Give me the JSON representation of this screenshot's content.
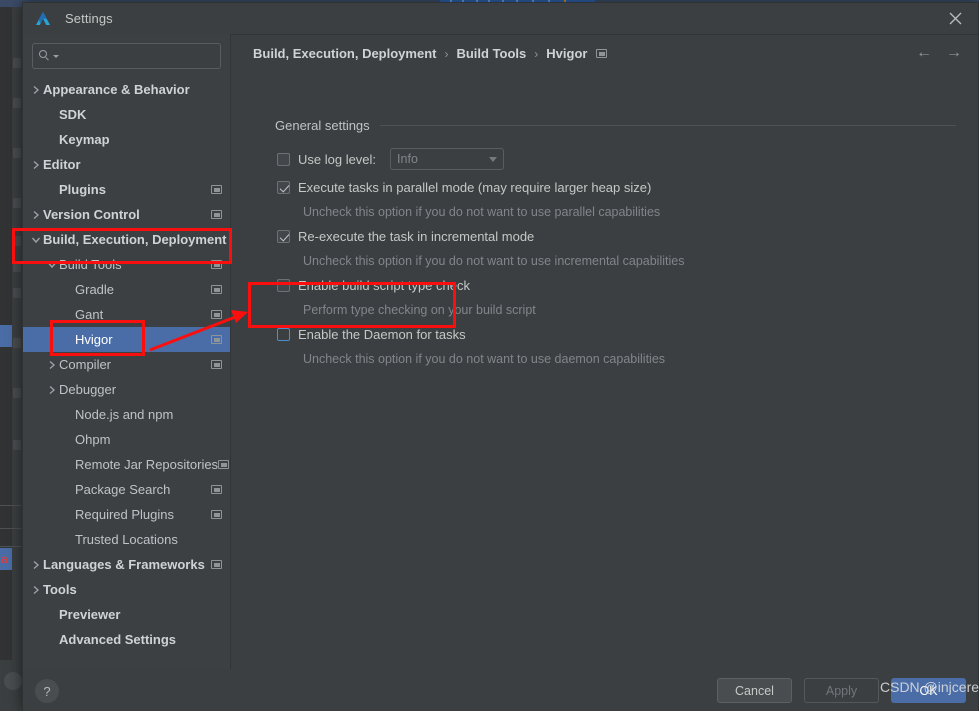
{
  "window": {
    "title": "Settings",
    "logo_icon": "devecostudio-logo-icon",
    "close_icon": "close-icon"
  },
  "search": {
    "value": "",
    "placeholder": "",
    "icon": "search-icon"
  },
  "sidebar": {
    "items": [
      {
        "label": "Appearance & Behavior",
        "indent": 0,
        "chevron": "right",
        "bold": true,
        "win_icon": false,
        "selected": false
      },
      {
        "label": "SDK",
        "indent": 1,
        "chevron": "none",
        "bold": true,
        "win_icon": false,
        "selected": false
      },
      {
        "label": "Keymap",
        "indent": 1,
        "chevron": "none",
        "bold": true,
        "win_icon": false,
        "selected": false
      },
      {
        "label": "Editor",
        "indent": 0,
        "chevron": "right",
        "bold": true,
        "win_icon": false,
        "selected": false
      },
      {
        "label": "Plugins",
        "indent": 1,
        "chevron": "none",
        "bold": true,
        "win_icon": true,
        "selected": false
      },
      {
        "label": "Version Control",
        "indent": 0,
        "chevron": "right",
        "bold": true,
        "win_icon": true,
        "selected": false
      },
      {
        "label": "Build, Execution, Deployment",
        "indent": 0,
        "chevron": "down",
        "bold": true,
        "win_icon": false,
        "selected": false
      },
      {
        "label": "Build Tools",
        "indent": 1,
        "chevron": "down",
        "bold": false,
        "win_icon": true,
        "selected": false
      },
      {
        "label": "Gradle",
        "indent": 2,
        "chevron": "none",
        "bold": false,
        "win_icon": true,
        "selected": false
      },
      {
        "label": "Gant",
        "indent": 2,
        "chevron": "none",
        "bold": false,
        "win_icon": true,
        "selected": false
      },
      {
        "label": "Hvigor",
        "indent": 2,
        "chevron": "none",
        "bold": false,
        "win_icon": true,
        "selected": true
      },
      {
        "label": "Compiler",
        "indent": 1,
        "chevron": "right",
        "bold": false,
        "win_icon": true,
        "selected": false
      },
      {
        "label": "Debugger",
        "indent": 1,
        "chevron": "right",
        "bold": false,
        "win_icon": false,
        "selected": false
      },
      {
        "label": "Node.js and npm",
        "indent": 2,
        "chevron": "none",
        "bold": false,
        "win_icon": false,
        "selected": false
      },
      {
        "label": "Ohpm",
        "indent": 2,
        "chevron": "none",
        "bold": false,
        "win_icon": false,
        "selected": false
      },
      {
        "label": "Remote Jar Repositories",
        "indent": 2,
        "chevron": "none",
        "bold": false,
        "win_icon": true,
        "selected": false
      },
      {
        "label": "Package Search",
        "indent": 2,
        "chevron": "none",
        "bold": false,
        "win_icon": true,
        "selected": false
      },
      {
        "label": "Required Plugins",
        "indent": 2,
        "chevron": "none",
        "bold": false,
        "win_icon": true,
        "selected": false
      },
      {
        "label": "Trusted Locations",
        "indent": 2,
        "chevron": "none",
        "bold": false,
        "win_icon": false,
        "selected": false
      },
      {
        "label": "Languages & Frameworks",
        "indent": 0,
        "chevron": "right",
        "bold": true,
        "win_icon": true,
        "selected": false
      },
      {
        "label": "Tools",
        "indent": 0,
        "chevron": "right",
        "bold": true,
        "win_icon": false,
        "selected": false
      },
      {
        "label": "Previewer",
        "indent": 1,
        "chevron": "none",
        "bold": true,
        "win_icon": false,
        "selected": false
      },
      {
        "label": "Advanced Settings",
        "indent": 1,
        "chevron": "none",
        "bold": true,
        "win_icon": false,
        "selected": false
      }
    ]
  },
  "breadcrumb": {
    "crumbs": [
      "Build, Execution, Deployment",
      "Build Tools",
      "Hvigor"
    ],
    "separator": "›",
    "trailing_icon": "window-icon",
    "back_icon": "←",
    "forward_icon": "→"
  },
  "main": {
    "section_title": "General settings",
    "options": [
      {
        "label": "Use log level:",
        "checked": false,
        "focused": false,
        "hint": "",
        "combo_value": "Info"
      },
      {
        "label": "Execute tasks in parallel mode (may require larger heap size)",
        "checked": true,
        "focused": false,
        "hint": "Uncheck this option if you do not want to use parallel capabilities"
      },
      {
        "label": "Re-execute the task in incremental mode",
        "checked": true,
        "focused": false,
        "hint": "Uncheck this option if you do not want to use incremental capabilities"
      },
      {
        "label": "Enable build script type check",
        "checked": false,
        "focused": false,
        "hint": "Perform type checking on your build script"
      },
      {
        "label": "Enable the Daemon for tasks",
        "checked": false,
        "focused": true,
        "hint": "Uncheck this option if you do not want to use daemon capabilities"
      }
    ]
  },
  "footer": {
    "help_label": "?",
    "cancel_label": "Cancel",
    "apply_label": "Apply",
    "ok_label": "OK"
  },
  "annotations": {
    "watermark": "CSDN @injcere",
    "highlight_color": "#fa0f0f",
    "boxes": [
      {
        "name": "build-execution-deployment-highlight"
      },
      {
        "name": "hvigor-highlight"
      },
      {
        "name": "enable-daemon-highlight"
      }
    ],
    "arrow": "arrow-pointing-to-enable-daemon"
  },
  "background": {
    "visible_label": "a"
  }
}
